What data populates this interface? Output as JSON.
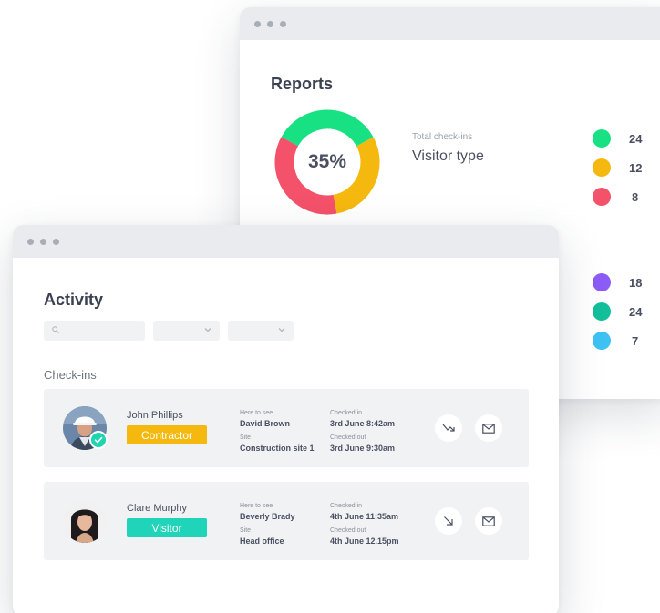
{
  "reports": {
    "title": "Reports",
    "donut": {
      "percent_label": "35%",
      "segments": [
        {
          "name": "green",
          "color": "#18e183",
          "share": 0.34
        },
        {
          "name": "yellow",
          "color": "#f5b80f",
          "share": 0.3
        },
        {
          "name": "red",
          "color": "#f4516a",
          "share": 0.36
        }
      ]
    },
    "total_label": "Total check-ins",
    "subtitle": "Visitor type",
    "legend": [
      {
        "color": "#18e183",
        "value": "24"
      },
      {
        "color": "#f5b80f",
        "value": "12"
      },
      {
        "color": "#f4516a",
        "value": "8"
      },
      {
        "color": "#8b5cf6",
        "value": "18"
      },
      {
        "color": "#12bf9a",
        "value": "24"
      },
      {
        "color": "#3ec1f3",
        "value": "7"
      }
    ]
  },
  "activity": {
    "title": "Activity",
    "search_icon": "search-icon",
    "section_label": "Check-ins",
    "checkins": [
      {
        "name": "John Phillips",
        "badge": "Contractor",
        "badge_color": "#f5b80f",
        "verified": true,
        "here_to_see_label": "Here to see",
        "here_to_see": "David Brown",
        "site_label": "Site",
        "site": "Construction site 1",
        "checked_in_label": "Checked in",
        "checked_in": "3rd June 8:42am",
        "checked_out_label": "Checked out",
        "checked_out": "3rd June 9:30am",
        "arrow_icon": "arrow-up-right-icon",
        "mail_icon": "mail-icon"
      },
      {
        "name": "Clare Murphy",
        "badge": "Visitor",
        "badge_color": "#1fd4b8",
        "verified": false,
        "here_to_see_label": "Here to see",
        "here_to_see": "Beverly Brady",
        "site_label": "Site",
        "site": "Head office",
        "checked_in_label": "Checked in",
        "checked_in": "4th June 11:35am",
        "checked_out_label": "Checked out",
        "checked_out": "4th June 12.15pm",
        "arrow_icon": "arrow-down-right-icon",
        "mail_icon": "mail-icon"
      }
    ]
  }
}
